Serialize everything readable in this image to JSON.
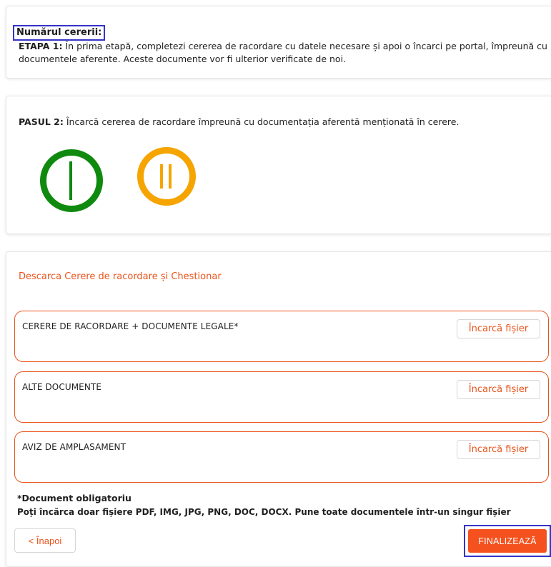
{
  "stage1": {
    "request_number_label": "Numărul cererii:",
    "stage_label": "ETAPA 1:",
    "stage_text": " În prima etapă, completezi cererea de racordare cu datele necesare și apoi o încarci pe portal, împreună cu documentele aferente. Aceste documente vor fi ulterior verificate de noi."
  },
  "step2": {
    "step_label": "PASUL 2:",
    "step_text": "  Încarcă cererea de racordare împreună cu documentația aferentă menționată în cerere."
  },
  "icons": {
    "power_icon_color": "#0f8a0f",
    "pause_icon_color": "#f5a400"
  },
  "uploads": {
    "download_link": "Descarca Cerere de racordare și Chestionar",
    "items": [
      {
        "label": "CERERE DE RACORDARE + DOCUMENTE LEGALE*",
        "button": "Încarcă fișier"
      },
      {
        "label": "ALTE DOCUMENTE",
        "button": "Încarcă fișier"
      },
      {
        "label": "AVIZ DE AMPLASAMENT",
        "button": "Încarcă fișier"
      }
    ],
    "required_note": "*Document obligatoriu",
    "format_note": "Poți încărca doar fișiere PDF, IMG, JPG, PNG, DOC, DOCX. Pune toate documentele într-un singur fișier"
  },
  "actions": {
    "back_label": "< Înapoi",
    "finalize_label": "FINALIZEAZĂ"
  },
  "colors": {
    "accent": "#e9541c",
    "highlight_border": "#3434c8"
  }
}
